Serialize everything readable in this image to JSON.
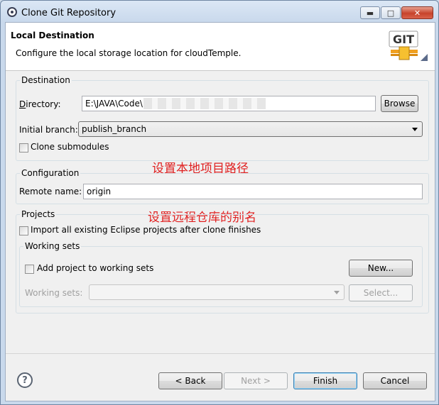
{
  "window": {
    "title": "Clone Git Repository",
    "minimize_icon": "minimize-icon",
    "maximize_icon": "maximize-icon",
    "close_icon": "close-icon"
  },
  "banner": {
    "title": "Local Destination",
    "description": "Configure the local storage location for cloudTemple.",
    "logo_text": "GIT"
  },
  "destination": {
    "group_label": "Destination",
    "directory_label": "Directory:",
    "directory_value": "E:\\JAVA\\Code\\",
    "browse_label": "Browse",
    "branch_label": "Initial branch:",
    "branch_value": "publish_branch",
    "clone_submodules_label": "Clone submodules",
    "clone_submodules_checked": false
  },
  "configuration": {
    "group_label": "Configuration",
    "remote_name_label": "Remote name:",
    "remote_name_value": "origin"
  },
  "projects": {
    "group_label": "Projects",
    "import_label": "Import all existing Eclipse projects after clone finishes",
    "import_checked": false,
    "working_sets": {
      "group_label": "Working sets",
      "add_label": "Add project to working sets",
      "add_checked": false,
      "new_label": "New...",
      "sets_label": "Working sets:",
      "sets_value": "",
      "select_label": "Select..."
    }
  },
  "annotations": {
    "local_path": "设置本地项目路径",
    "remote_alias": "设置远程仓库的别名"
  },
  "footer": {
    "help_icon": "help-icon",
    "back_label": "< Back",
    "next_label": "Next >",
    "finish_label": "Finish",
    "cancel_label": "Cancel"
  },
  "colors": {
    "annotation": "#e02020",
    "git_logo_orange": "#f0a020",
    "default_button_border": "#3c7fb1"
  }
}
